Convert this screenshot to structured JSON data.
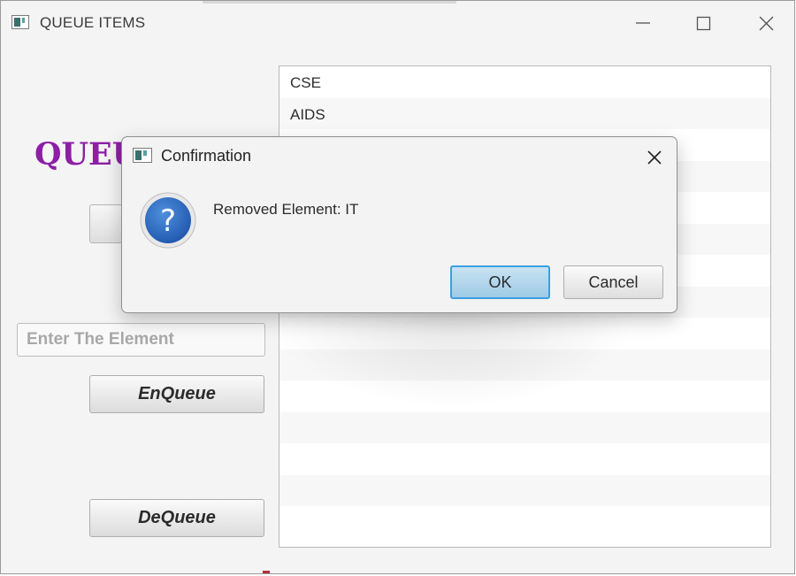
{
  "window": {
    "title": "QUEUE ITEMS",
    "controls": {
      "minimize": "minimize-icon",
      "maximize": "maximize-icon",
      "close": "close-icon"
    }
  },
  "main": {
    "heading": "QUEU",
    "element_input": {
      "value": "",
      "placeholder": "Enter The Element"
    },
    "enqueue_label": "EnQueue",
    "dequeue_label": "DeQueue",
    "queue_items": [
      "CSE",
      "AIDS",
      "",
      "",
      "",
      "",
      "",
      "",
      "",
      "",
      "",
      "",
      "",
      "",
      ""
    ]
  },
  "dialog": {
    "title": "Confirmation",
    "icon": "question-icon",
    "message": "Removed Element: IT",
    "ok_label": "OK",
    "cancel_label": "Cancel"
  },
  "colors": {
    "heading": "#8c1fa6",
    "ok_button": "#9fcbe6",
    "ok_border": "#3b9fe0",
    "question_icon": "#2f6fc0"
  }
}
